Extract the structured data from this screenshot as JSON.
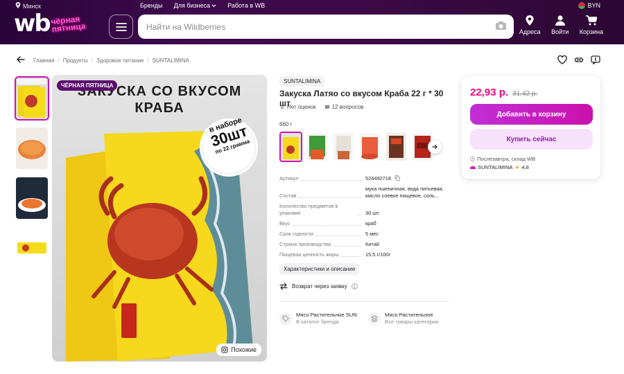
{
  "header": {
    "location": "Минск",
    "top_links": [
      "Бренды",
      "Для бизнеса",
      "Работа в WB"
    ],
    "currency": "BYN",
    "logo_text": "wb",
    "logo_promo": "чёрная пятница",
    "search_placeholder": "Найти на Wildberries",
    "icons": [
      {
        "label": "Адреса",
        "icon": "location-pin-icon"
      },
      {
        "label": "Войти",
        "icon": "user-icon"
      },
      {
        "label": "Корзина",
        "icon": "cart-icon"
      }
    ],
    "accent": "#cb11ab"
  },
  "breadcrumbs": [
    "Главная",
    "Продукты",
    "Здоровое питание",
    "SUNTALIMINA"
  ],
  "gallery": {
    "badge": "ЧЁРНАЯ ПЯТНИЦА",
    "similar_label": "Похожие",
    "image_headline_1": "ЗАКУСКА СО ВКУСОМ",
    "image_headline_2": "КРАБА",
    "image_sticker_1": "в наборе",
    "image_sticker_2": "30шт",
    "image_sticker_3": "по 22 грамма",
    "thumbnail_count": 4
  },
  "product": {
    "brand": "SUNTALIMINA",
    "title": "Закуска Латяо со вкусом Краба 22 г * 30 шт",
    "no_ratings": "Нет оценок",
    "questions": "12 вопросов",
    "variant_label": "660 г",
    "variant_count": 6,
    "specs": [
      {
        "key": "Артикул",
        "value": "524492718"
      },
      {
        "key": "Состав",
        "value": "мука пшеничная, вода питьевая, масло соевое пищевое, соль..."
      },
      {
        "key": "Количество предметов в упаковке",
        "value": "30 шт."
      },
      {
        "key": "Вкус",
        "value": "краб"
      },
      {
        "key": "Срок годности",
        "value": "5 мес"
      },
      {
        "key": "Страна производства",
        "value": "Китай"
      },
      {
        "key": "Пищевая ценность жиры",
        "value": "15.5 г/100г"
      }
    ],
    "characteristics_button": "Характеристики и описание",
    "returns": "Возврат через заявку",
    "brand_links": [
      {
        "title": "Мясо Растительное SUN",
        "subtitle": "В каталог бренда",
        "icon": "tag-icon"
      },
      {
        "title": "Мясо Растительное",
        "subtitle": "Все товары категории",
        "icon": "layers-icon"
      }
    ]
  },
  "buy_card": {
    "price": "22,93 р.",
    "old_price": "31,42 р.",
    "add_to_cart": "Добавить в корзину",
    "buy_now": "Купить сейчас",
    "delivery": "Послезавтра, склад WB",
    "seller": "SUNTALIMINA",
    "seller_rating": "4,8",
    "price_color": "#f0067e"
  }
}
